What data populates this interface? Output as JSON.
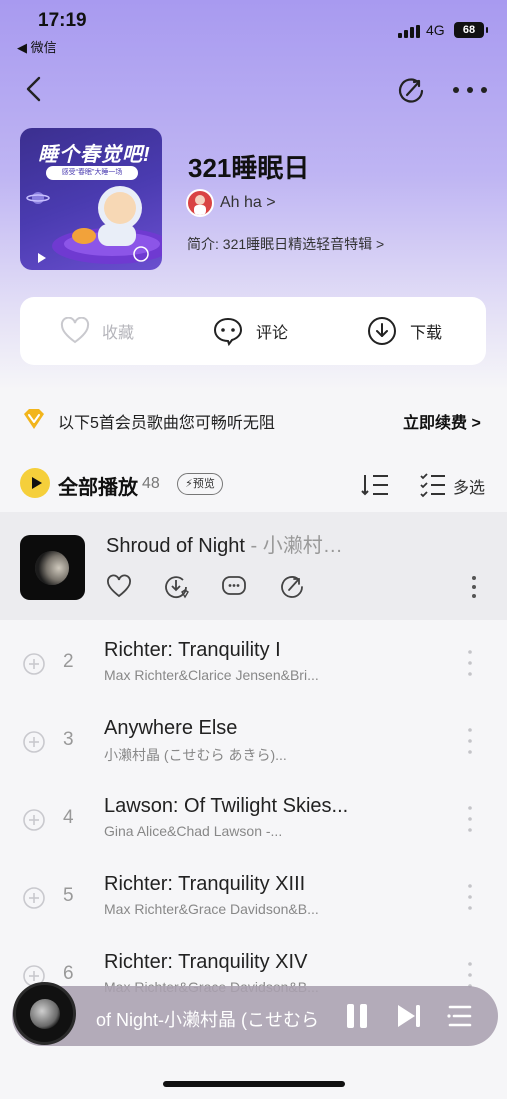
{
  "status_bar": {
    "time": "17:19",
    "back_app": "◀ 微信",
    "network": "4G",
    "battery": "68"
  },
  "playlist": {
    "cover_title": "睡个春觉吧!",
    "cover_subtitle": "感受“春眠”大睡一场",
    "title": "321睡眠日",
    "creator": "Ah ha >",
    "intro": "简介: 321睡眠日精选轻音特辑 >"
  },
  "actions": {
    "collect": "收藏",
    "comment": "评论",
    "download": "下载"
  },
  "vip": {
    "text": "以下5首会员歌曲您可畅听无阻",
    "renew": "立即续费 >"
  },
  "play_all": {
    "label": "全部播放",
    "count": "48",
    "preview_badge": "⚡预览",
    "multi_select": "多选"
  },
  "current_song": {
    "title": "Shroud of Night",
    "separator": " - ",
    "artist": "小濑村…"
  },
  "songs": [
    {
      "num": "2",
      "title": "Richter: Tranquility I",
      "artist": "Max Richter&Clarice Jensen&Bri..."
    },
    {
      "num": "3",
      "title": "Anywhere Else",
      "artist": "小濑村晶 (こせむら あきら)..."
    },
    {
      "num": "4",
      "title": "Lawson: Of Twilight Skies...",
      "artist": "Gina Alice&Chad Lawson -..."
    },
    {
      "num": "5",
      "title": "Richter: Tranquility XIII",
      "artist": "Max Richter&Grace Davidson&B..."
    },
    {
      "num": "6",
      "title": "Richter: Tranquility XIV",
      "artist": "Max Richter&Grace Davidson&B..."
    }
  ],
  "player": {
    "now_playing": "of Night-小濑村晶 (こせむら"
  },
  "colors": {
    "accent_yellow": "#f5cf3b",
    "hero_purple": "#a89af0",
    "vip_gold": "#f2b51c"
  }
}
